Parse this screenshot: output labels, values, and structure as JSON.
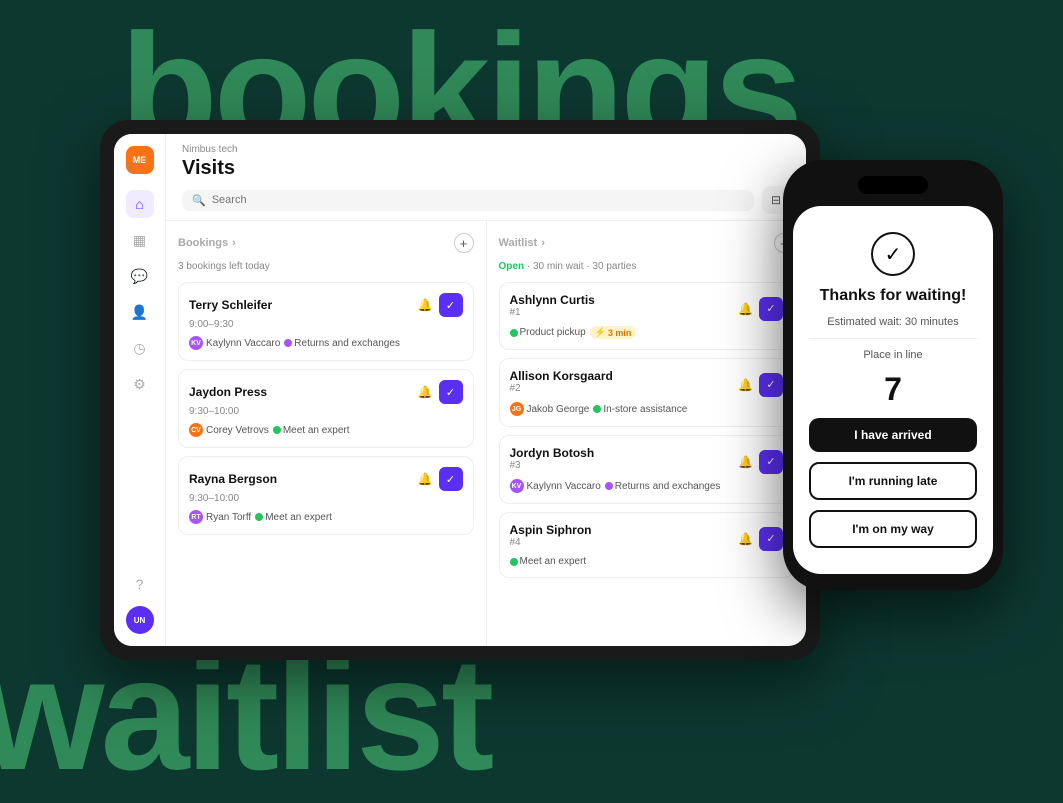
{
  "background": {
    "text_bookings": "bookings",
    "text_waitlist": "waitlist"
  },
  "tablet": {
    "sidebar": {
      "company_avatar": "ME",
      "bottom_avatar": "UN",
      "icons": [
        "home",
        "calendar",
        "message",
        "people",
        "clock",
        "settings",
        "help"
      ]
    },
    "header": {
      "company_name": "Nimbus tech",
      "page_title": "Visits",
      "search_placeholder": "Search"
    },
    "bookings_column": {
      "title": "Bookings",
      "chevron": "›",
      "subtitle": "3 bookings left today",
      "cards": [
        {
          "name": "Terry Schleifer",
          "time": "9:00–9:30",
          "person_name": "Kaylynn Vaccaro",
          "tag_color": "#a855f7",
          "tag_label": "Returns and exchanges",
          "tag_dot_color": "#a855f7"
        },
        {
          "name": "Jaydon Press",
          "time": "9:30–10:00",
          "person_name": "Corey Vetrovs",
          "tag_color": "#f97316",
          "tag_label": "Meet an expert",
          "tag_dot_color": "#22c55e"
        },
        {
          "name": "Rayna Bergson",
          "time": "9:30–10:00",
          "person_name": "Ryan Torff",
          "tag_color": "#a855f7",
          "tag_label": "Meet an expert",
          "tag_dot_color": "#22c55e"
        }
      ]
    },
    "waitlist_column": {
      "title": "Waitlist",
      "chevron": "›",
      "status_open": "Open",
      "status_wait": "30 min wait",
      "status_parties": "30 parties",
      "cards": [
        {
          "name": "Ashlynn Curtis",
          "number": "#1",
          "tag_label": "Product pickup",
          "tag_dot_color": "#22c55e",
          "time_badge": "3 min",
          "person_name": null
        },
        {
          "name": "Allison Korsgaard",
          "number": "#2",
          "person_name": "Jakob George",
          "person_color": "#f97316",
          "tag_label": "In-store assistance",
          "tag_dot_color": "#22c55e"
        },
        {
          "name": "Jordyn Botosh",
          "number": "#3",
          "person_name": "Kaylynn Vaccaro",
          "person_color": "#a855f7",
          "tag_label": "Returns and exchanges",
          "tag_dot_color": "#a855f7"
        },
        {
          "name": "Aspin Siphron",
          "number": "#4",
          "person_name": null,
          "tag_label": "Meet an expert",
          "tag_dot_color": "#22c55e"
        }
      ]
    }
  },
  "phone": {
    "check_symbol": "✓",
    "title": "Thanks for waiting!",
    "subtitle": "Estimated wait: 30 minutes",
    "place_label": "Place in line",
    "place_number": "7",
    "btn_arrived": "I have arrived",
    "btn_late": "I'm running late",
    "btn_on_way": "I'm on my way"
  }
}
